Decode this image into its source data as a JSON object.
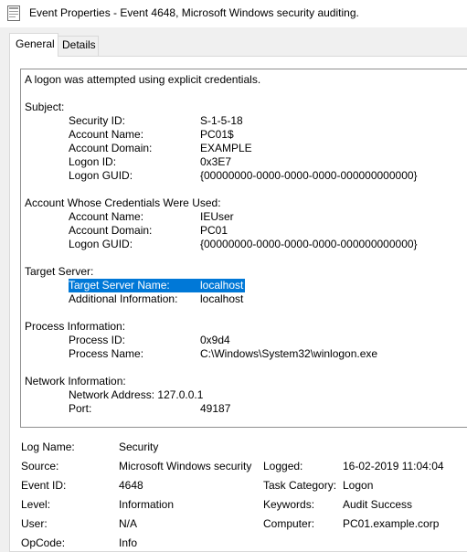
{
  "window": {
    "title": "Event Properties - Event 4648, Microsoft Windows security auditing.",
    "icon": "event-viewer-icon"
  },
  "tabs": [
    {
      "label": "General",
      "active": true
    },
    {
      "label": "Details",
      "active": false
    }
  ],
  "description": {
    "intro": "A logon was attempted using explicit credentials.",
    "subject": {
      "heading": "Subject:",
      "rows": [
        {
          "label": "Security ID:",
          "value": "S-1-5-18"
        },
        {
          "label": "Account Name:",
          "value": "PC01$"
        },
        {
          "label": "Account Domain:",
          "value": "EXAMPLE"
        },
        {
          "label": "Logon ID:",
          "value": "0x3E7"
        },
        {
          "label": "Logon GUID:",
          "value": "{00000000-0000-0000-0000-000000000000}"
        }
      ]
    },
    "credentials": {
      "heading": "Account Whose Credentials Were Used:",
      "rows": [
        {
          "label": "Account Name:",
          "value": "IEUser"
        },
        {
          "label": "Account Domain:",
          "value": "PC01"
        },
        {
          "label": "Logon GUID:",
          "value": "{00000000-0000-0000-0000-000000000000}"
        }
      ]
    },
    "target": {
      "heading": "Target Server:",
      "rows": [
        {
          "label": "Target Server Name:",
          "value": "localhost"
        },
        {
          "label": "Additional Information:",
          "value": "localhost"
        }
      ]
    },
    "process": {
      "heading": "Process Information:",
      "rows": [
        {
          "label": "Process ID:",
          "value": "0x9d4"
        },
        {
          "label": "Process Name:",
          "value": "C:\\Windows\\System32\\winlogon.exe"
        }
      ]
    },
    "network": {
      "heading": "Network Information:",
      "rows": [
        {
          "label": "Network Address:",
          "value": "127.0.0.1"
        },
        {
          "label": "Port:",
          "value": "49187"
        }
      ]
    }
  },
  "fields": {
    "log_name": {
      "label": "Log Name:",
      "value": "Security"
    },
    "source": {
      "label": "Source:",
      "value": "Microsoft Windows security"
    },
    "logged": {
      "label": "Logged:",
      "value": "16-02-2019 11:04:04"
    },
    "event_id": {
      "label": "Event ID:",
      "value": "4648"
    },
    "task_category": {
      "label": "Task Category:",
      "value": "Logon"
    },
    "level": {
      "label": "Level:",
      "value": "Information"
    },
    "keywords": {
      "label": "Keywords:",
      "value": "Audit Success"
    },
    "user": {
      "label": "User:",
      "value": "N/A"
    },
    "computer": {
      "label": "Computer:",
      "value": "PC01.example.corp"
    },
    "opcode": {
      "label": "OpCode:",
      "value": "Info"
    }
  },
  "colors": {
    "selection": "#0078d7",
    "dialog_background": "#f0f0f0"
  }
}
